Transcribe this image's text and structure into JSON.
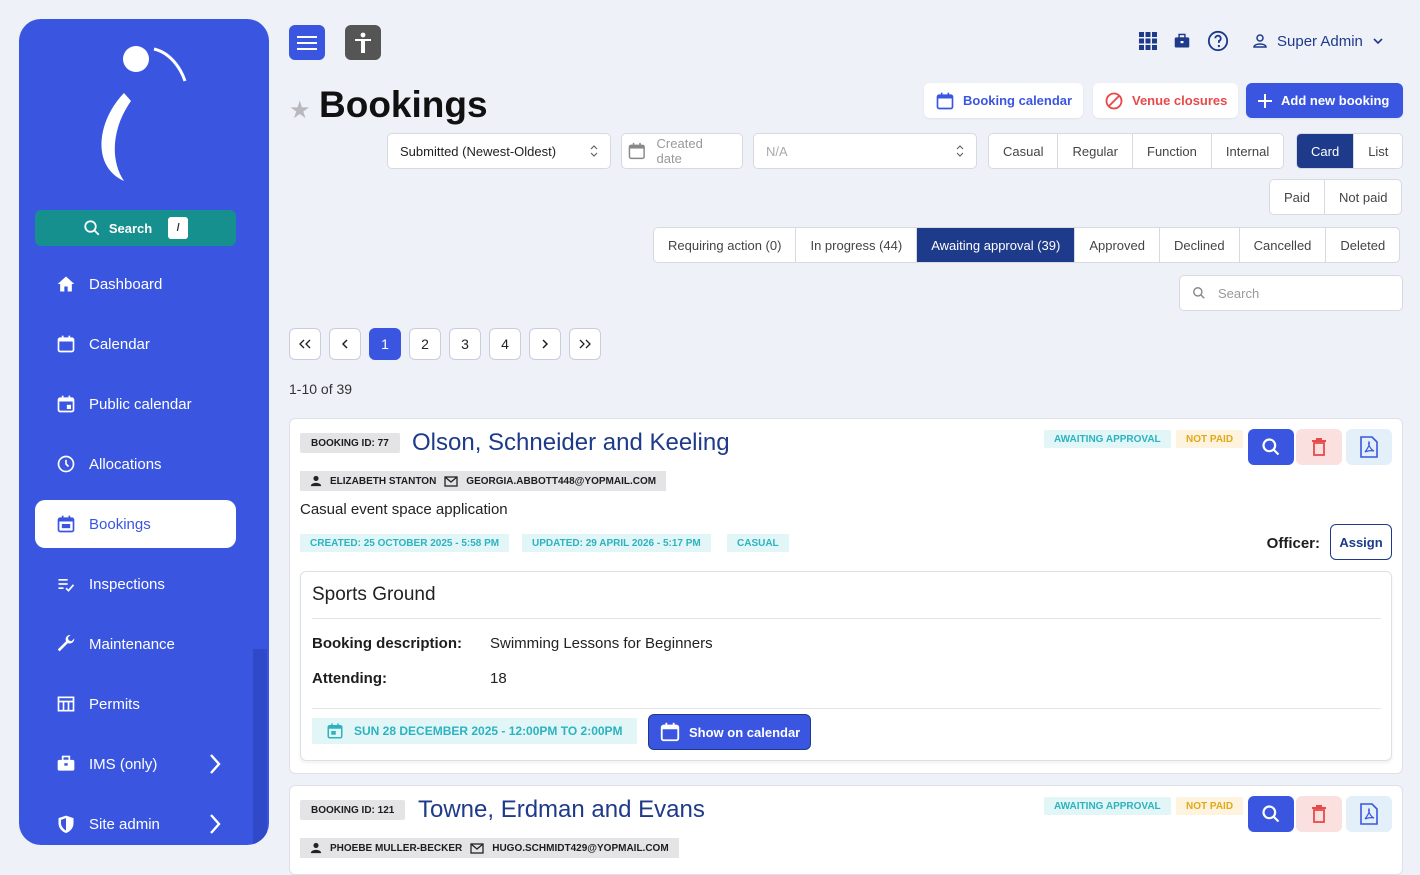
{
  "sidebar": {
    "search_label": "Search",
    "search_shortcut": "/",
    "items": [
      {
        "label": "Dashboard",
        "icon": "home-icon"
      },
      {
        "label": "Calendar",
        "icon": "calendar-icon"
      },
      {
        "label": "Public calendar",
        "icon": "calendar-event-icon"
      },
      {
        "label": "Allocations",
        "icon": "clock-icon"
      },
      {
        "label": "Bookings",
        "icon": "calendar-check-icon",
        "active": true
      },
      {
        "label": "Inspections",
        "icon": "checklist-icon"
      },
      {
        "label": "Maintenance",
        "icon": "wrench-icon"
      },
      {
        "label": "Permits",
        "icon": "table-icon"
      },
      {
        "label": "IMS (only)",
        "icon": "briefcase-icon"
      },
      {
        "label": "Site admin",
        "icon": "shield-icon"
      }
    ]
  },
  "topbar": {
    "user": "Super Admin"
  },
  "header": {
    "title": "Bookings",
    "booking_calendar": "Booking calendar",
    "venue_closures": "Venue closures",
    "add_new": "Add new booking"
  },
  "filters": {
    "sort_value": "Submitted (Newest-Oldest)",
    "date_placeholder": "Created date",
    "venue_placeholder": "N/A",
    "types": [
      "Casual",
      "Regular",
      "Function",
      "Internal"
    ],
    "views": [
      "Card",
      "List"
    ],
    "active_view": "Card",
    "payment": [
      "Paid",
      "Not paid"
    ],
    "statuses": [
      "Requiring action (0)",
      "In progress (44)",
      "Awaiting approval (39)",
      "Approved",
      "Declined",
      "Cancelled",
      "Deleted"
    ],
    "active_status": "Awaiting approval (39)",
    "search_placeholder": "Search"
  },
  "pagination": {
    "pages": [
      "1",
      "2",
      "3",
      "4"
    ],
    "current": "1",
    "summary": "1-10 of 39"
  },
  "bookings": [
    {
      "id": "BOOKING ID: 77",
      "title": "Olson, Schneider and Keeling",
      "status": "AWAITING APPROVAL",
      "payment": "NOT PAID",
      "contact_name": "ELIZABETH STANTON",
      "contact_email": "GEORGIA.ABBOTT448@YOPMAIL.COM",
      "subtitle": "Casual event space application",
      "created": "CREATED: 25 OCTOBER 2025 - 5:58 PM",
      "updated": "UPDATED: 29 APRIL 2026 - 5:17 PM",
      "type": "CASUAL",
      "officer_label": "Officer:",
      "assign_label": "Assign",
      "venue": "Sports Ground",
      "desc_label": "Booking description:",
      "desc": "Swimming Lessons for Beginners",
      "attending_label": "Attending:",
      "attending": "18",
      "date": "SUN 28 DECEMBER 2025 - 12:00PM TO 2:00PM",
      "show_calendar": "Show on calendar"
    },
    {
      "id": "BOOKING ID: 121",
      "title": "Towne, Erdman and Evans",
      "status": "AWAITING APPROVAL",
      "payment": "NOT PAID",
      "contact_name": "PHOEBE MULLER-BECKER",
      "contact_email": "HUGO.SCHMIDT429@YOPMAIL.COM"
    }
  ]
}
